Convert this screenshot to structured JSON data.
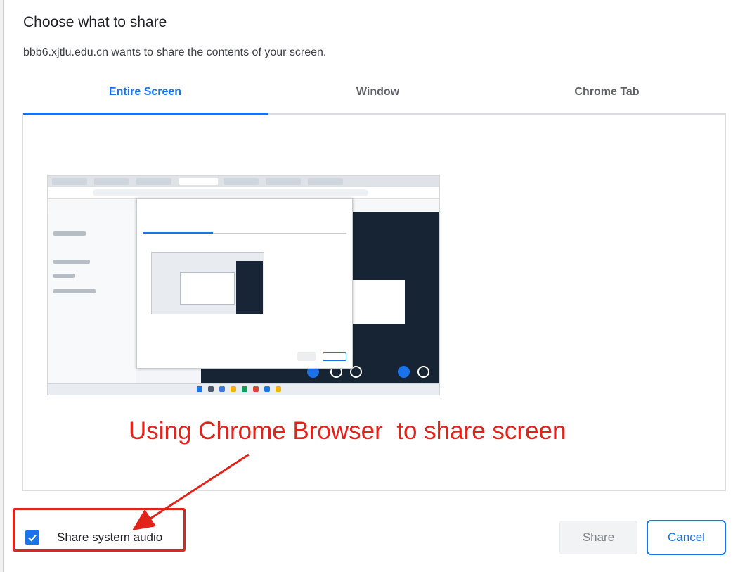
{
  "dialog": {
    "title": "Choose what to share",
    "subtitle": "bbb6.xjtlu.edu.cn wants to share the contents of your screen."
  },
  "tabs": [
    {
      "label": "Entire Screen",
      "active": true
    },
    {
      "label": "Window",
      "active": false
    },
    {
      "label": "Chrome Tab",
      "active": false
    }
  ],
  "annotation": {
    "text": "Using Chrome Browser  to share screen",
    "color": "#e2231a"
  },
  "audio": {
    "label": "Share system audio",
    "checked": true
  },
  "buttons": {
    "share": "Share",
    "cancel": "Cancel"
  },
  "colors": {
    "accent": "#1a73e8",
    "annotation": "#e2231a"
  }
}
